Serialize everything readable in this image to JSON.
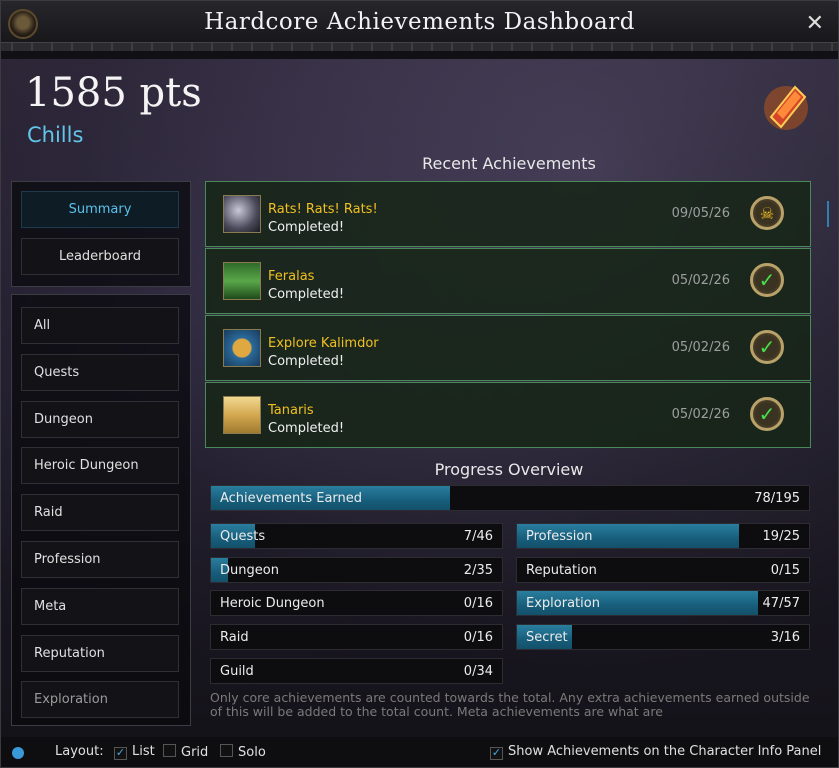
{
  "window": {
    "title": "Hardcore Achievements Dashboard"
  },
  "player": {
    "points": "1585 pts",
    "name": "Chills"
  },
  "nav_top": [
    {
      "label": "Summary",
      "active": true
    },
    {
      "label": "Leaderboard",
      "active": false
    }
  ],
  "categories": [
    {
      "label": "All",
      "active": true
    },
    {
      "label": "Quests"
    },
    {
      "label": "Dungeon"
    },
    {
      "label": "Heroic Dungeon"
    },
    {
      "label": "Raid"
    },
    {
      "label": "Profession"
    },
    {
      "label": "Meta"
    },
    {
      "label": "Reputation"
    },
    {
      "label": "Exploration"
    }
  ],
  "recent": {
    "title": "Recent Achievements",
    "items": [
      {
        "name": "Rats! Rats! Rats!",
        "status": "Completed!",
        "date": "09/05/26",
        "badge_icon": "boss-medal-icon"
      },
      {
        "name": "Feralas",
        "status": "Completed!",
        "date": "05/02/26",
        "badge_icon": "checkmark-icon"
      },
      {
        "name": "Explore Kalimdor",
        "status": "Completed!",
        "date": "05/02/26",
        "badge_icon": "checkmark-icon"
      },
      {
        "name": "Tanaris",
        "status": "Completed!",
        "date": "05/02/26",
        "badge_icon": "checkmark-icon"
      }
    ]
  },
  "progress": {
    "title": "Progress Overview",
    "total": {
      "label": "Achievements Earned",
      "value": "78/195",
      "fraction": 0.4
    },
    "left": [
      {
        "label": "Quests",
        "value": "7/46",
        "fraction": 0.152
      },
      {
        "label": "Dungeon",
        "value": "2/35",
        "fraction": 0.057
      },
      {
        "label": "Heroic Dungeon",
        "value": "0/16",
        "fraction": 0
      },
      {
        "label": "Raid",
        "value": "0/16",
        "fraction": 0
      },
      {
        "label": "Guild",
        "value": "0/34",
        "fraction": 0
      }
    ],
    "right": [
      {
        "label": "Profession",
        "value": "19/25",
        "fraction": 0.76
      },
      {
        "label": "Reputation",
        "value": "0/15",
        "fraction": 0
      },
      {
        "label": "Exploration",
        "value": "47/57",
        "fraction": 0.825
      },
      {
        "label": "Secret",
        "value": "3/16",
        "fraction": 0.1875
      }
    ],
    "note": "Only core achievements are counted towards the total. Any extra achievements earned outside of this will be added to the total count. Meta achievements are what are"
  },
  "footer": {
    "layout_label": "Layout:",
    "options": [
      {
        "label": "List",
        "checked": true
      },
      {
        "label": "Grid",
        "checked": false
      },
      {
        "label": "Solo",
        "checked": false
      }
    ],
    "show_panel_label": "Show Achievements on the Character Info Panel",
    "show_panel_checked": true
  },
  "colors": {
    "accent": "#61c6ea",
    "achievement_name": "#f0c020",
    "bar_fill": "#2a7e9e",
    "complete_border": "#4a8a5a"
  }
}
